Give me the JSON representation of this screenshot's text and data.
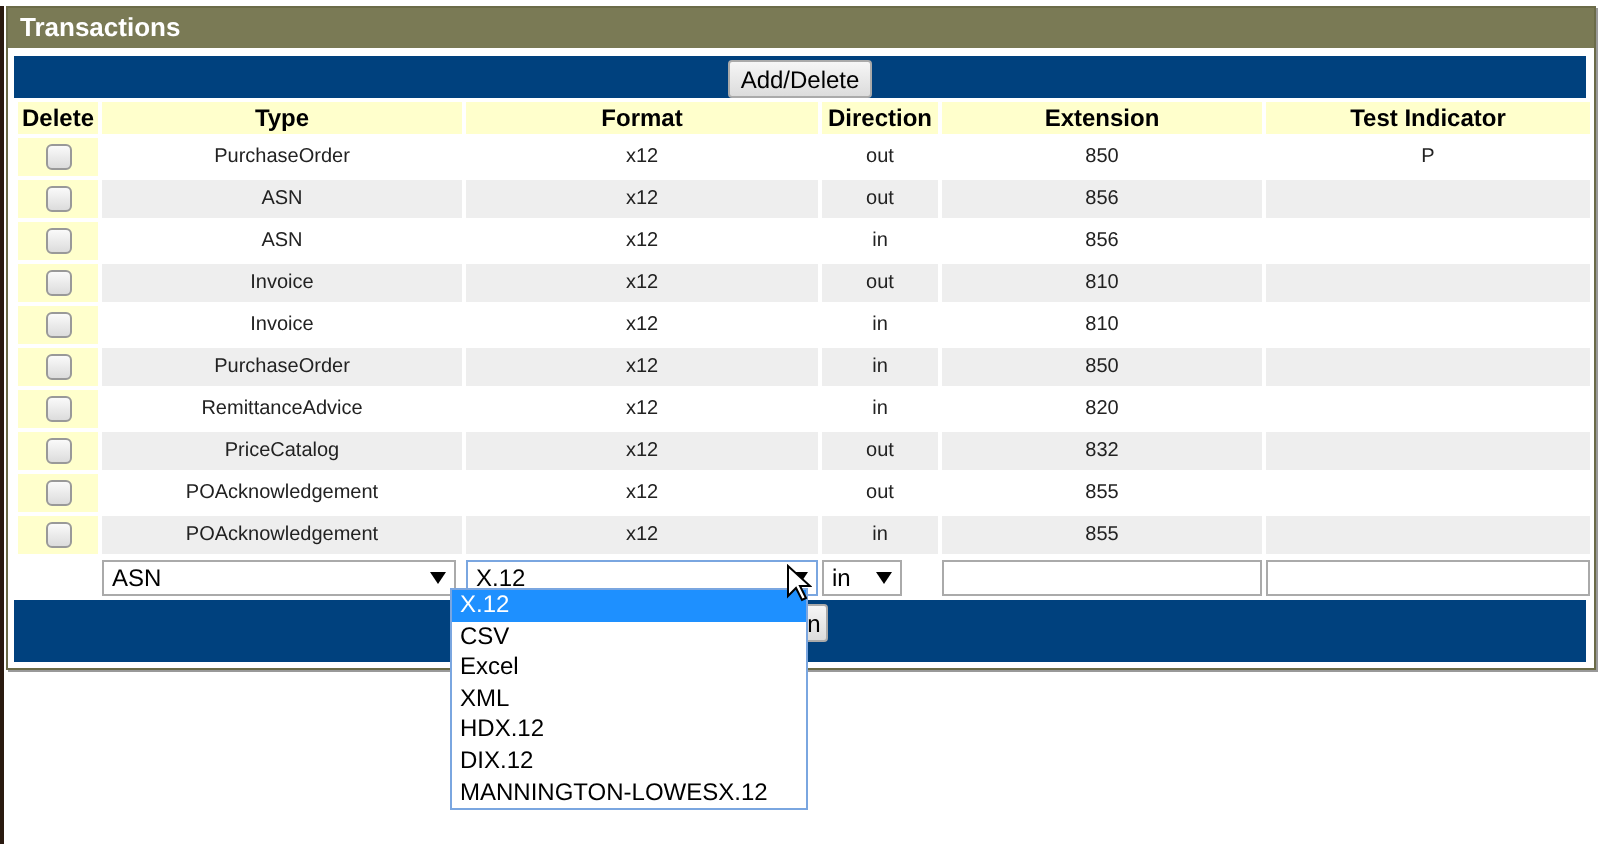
{
  "panel": {
    "title": "Transactions"
  },
  "top_button": "Add/Delete",
  "table": {
    "columns": [
      "Delete",
      "Type",
      "Format",
      "Direction",
      "Extension",
      "Test Indicator"
    ],
    "rows": [
      {
        "checked": false,
        "type": "PurchaseOrder",
        "format": "x12",
        "direction": "out",
        "extension": "850",
        "test_indicator": "P"
      },
      {
        "checked": false,
        "type": "ASN",
        "format": "x12",
        "direction": "out",
        "extension": "856",
        "test_indicator": ""
      },
      {
        "checked": false,
        "type": "ASN",
        "format": "x12",
        "direction": "in",
        "extension": "856",
        "test_indicator": ""
      },
      {
        "checked": false,
        "type": "Invoice",
        "format": "x12",
        "direction": "out",
        "extension": "810",
        "test_indicator": ""
      },
      {
        "checked": false,
        "type": "Invoice",
        "format": "x12",
        "direction": "in",
        "extension": "810",
        "test_indicator": ""
      },
      {
        "checked": false,
        "type": "PurchaseOrder",
        "format": "x12",
        "direction": "in",
        "extension": "850",
        "test_indicator": ""
      },
      {
        "checked": false,
        "type": "RemittanceAdvice",
        "format": "x12",
        "direction": "in",
        "extension": "820",
        "test_indicator": ""
      },
      {
        "checked": false,
        "type": "PriceCatalog",
        "format": "x12",
        "direction": "out",
        "extension": "832",
        "test_indicator": ""
      },
      {
        "checked": false,
        "type": "POAcknowledgement",
        "format": "x12",
        "direction": "out",
        "extension": "855",
        "test_indicator": ""
      },
      {
        "checked": false,
        "type": "POAcknowledgement",
        "format": "x12",
        "direction": "in",
        "extension": "855",
        "test_indicator": ""
      }
    ]
  },
  "new_row": {
    "type": "ASN",
    "format": "X.12",
    "direction": "in",
    "format_open": true,
    "format_options": [
      {
        "label": "X.12",
        "selected": true
      },
      {
        "label": "CSV",
        "selected": false
      },
      {
        "label": "Excel",
        "selected": false
      },
      {
        "label": "XML",
        "selected": false
      },
      {
        "label": "HDX.12",
        "selected": false
      },
      {
        "label": "DIX.12",
        "selected": false
      },
      {
        "label": "MANNINGTON-LOWESX.12",
        "selected": false
      }
    ]
  },
  "bottom_button": "n"
}
